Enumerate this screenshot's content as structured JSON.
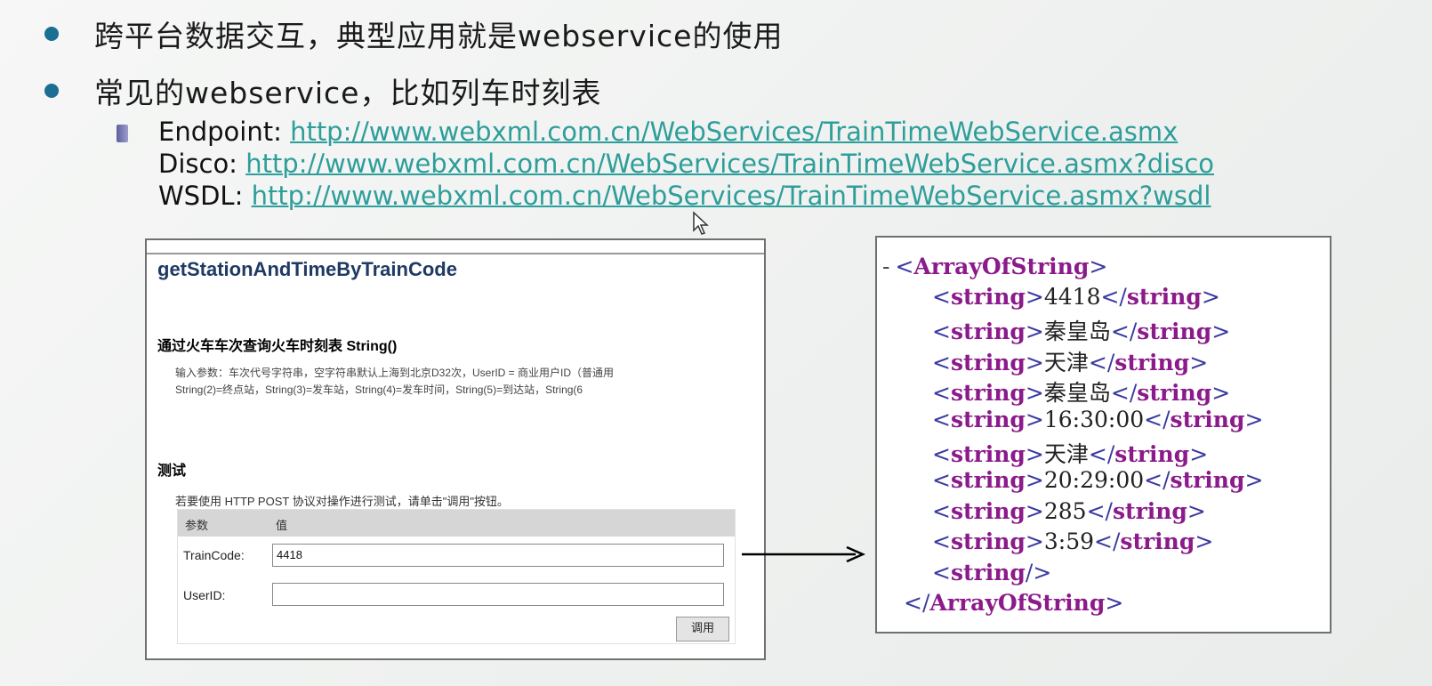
{
  "bullets": [
    "跨平台数据交互，典型应用就是webservice的使用",
    "常见的webservice，比如列车时刻表"
  ],
  "endpoints": {
    "endpoint_label": "Endpoint:",
    "endpoint_url": "http://www.webxml.com.cn/WebServices/TrainTimeWebService.asmx",
    "disco_label": "Disco:",
    "disco_url": "http://www.webxml.com.cn/WebServices/TrainTimeWebService.asmx?disco",
    "wsdl_label": "WSDL:",
    "wsdl_url": "http://www.webxml.com.cn/WebServices/TrainTimeWebService.asmx?wsdl"
  },
  "service_page": {
    "title": "getStationAndTimeByTrainCode",
    "operation": "通过火车车次查询火车时刻表 String()",
    "desc_line1": "输入参数：车次代号字符串，空字符串默认上海到北京D32次，UserID = 商业用户ID（普通用",
    "desc_line2": "String(2)=终点站，String(3)=发车站，String(4)=发车时间，String(5)=到达站，String(6",
    "test_heading": "测试",
    "test_hint": "若要使用 HTTP POST 协议对操作进行测试，请单击\"调用\"按钮。",
    "col_param": "参数",
    "col_value": "值",
    "traincode_label": "TrainCode:",
    "traincode_value": "4418",
    "userid_label": "UserID:",
    "userid_value": "",
    "invoke_button": "调用"
  },
  "xml_result": {
    "root_open": "ArrayOfString",
    "tag": "string",
    "values": [
      "4418",
      "秦皇岛",
      "天津",
      "秦皇岛",
      "16:30:00",
      "天津",
      "20:29:00",
      "285",
      "3:59"
    ],
    "root_close": "ArrayOfString"
  },
  "colors": {
    "bullet": "#1b6f93",
    "link": "#2e9e9a",
    "xml_tag": "#8b1a8b",
    "xml_bracket": "#3a3aa0"
  }
}
